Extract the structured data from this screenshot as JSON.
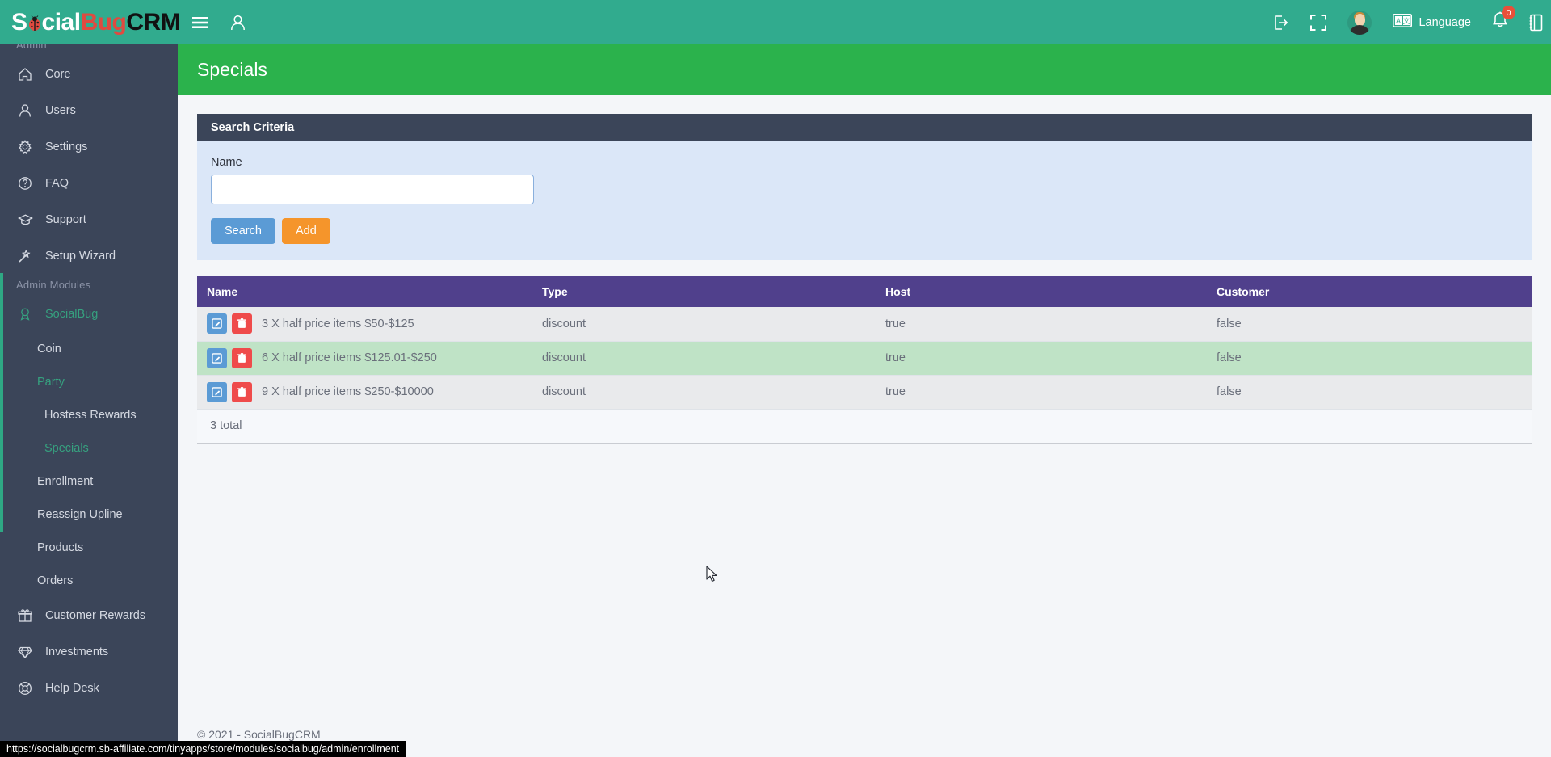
{
  "header": {
    "brand": {
      "part1": "S",
      "bug_glyph": "ladybug-icon",
      "part1b": "cial",
      "part2": "Bug",
      "part3": "CRM"
    },
    "left_icons": [
      {
        "name": "hamburger-menu-icon",
        "label": "Menu"
      },
      {
        "name": "user-icon",
        "label": "User"
      }
    ],
    "right_icons": [
      {
        "name": "logout-icon",
        "label": "Logout"
      },
      {
        "name": "fullscreen-icon",
        "label": "Fullscreen"
      },
      {
        "name": "avatar",
        "label": "Profile"
      }
    ],
    "language_label": "Language",
    "notification_count": "0",
    "accent_color": "#31ab8e"
  },
  "sidebar": {
    "section_admin": "Admin",
    "section_admin_modules": "Admin Modules",
    "admin_items": [
      {
        "label": "Core",
        "icon": "home-icon"
      },
      {
        "label": "Users",
        "icon": "user-icon"
      },
      {
        "label": "Settings",
        "icon": "gear-icon"
      },
      {
        "label": "FAQ",
        "icon": "question-circle-icon"
      },
      {
        "label": "Support",
        "icon": "graduation-cap-icon"
      },
      {
        "label": "Setup Wizard",
        "icon": "magic-wand-icon"
      }
    ],
    "module_socialbug": {
      "label": "SocialBug",
      "icon": "award-icon",
      "active": true
    },
    "socialbug_children": [
      {
        "label": "Coin",
        "active": false
      },
      {
        "label": "Party",
        "active": true
      },
      {
        "label": "Hostess Rewards",
        "active": false,
        "deep": true
      },
      {
        "label": "Specials",
        "active": true,
        "deep": true
      },
      {
        "label": "Enrollment",
        "active": false
      },
      {
        "label": "Reassign Upline",
        "active": false
      },
      {
        "label": "Products",
        "active": false
      },
      {
        "label": "Orders",
        "active": false
      }
    ],
    "other_modules": [
      {
        "label": "Customer Rewards",
        "icon": "gift-icon"
      },
      {
        "label": "Investments",
        "icon": "diamond-icon"
      },
      {
        "label": "Help Desk",
        "icon": "life-ring-icon"
      }
    ],
    "active_color": "#36a17f",
    "background_color": "#3b4559"
  },
  "page": {
    "title": "Specials",
    "title_bar_color": "#2bb24c"
  },
  "search_panel": {
    "heading": "Search Criteria",
    "name_label": "Name",
    "name_value": "",
    "name_placeholder": "",
    "search_button": "Search",
    "add_button": "Add"
  },
  "table": {
    "columns": [
      "Name",
      "Type",
      "Host",
      "Customer"
    ],
    "header_color": "#50408c",
    "rows": [
      {
        "name": "3 X half price items $50-$125",
        "type": "discount",
        "host": "true",
        "customer": "false",
        "highlight": false
      },
      {
        "name": "6 X half price items $125.01-$250",
        "type": "discount",
        "host": "true",
        "customer": "false",
        "highlight": true
      },
      {
        "name": "9 X half price items $250-$10000",
        "type": "discount",
        "host": "true",
        "customer": "false",
        "highlight": false
      }
    ],
    "total_label": "3 total",
    "edit_icon": "pencil-square-icon",
    "delete_icon": "trash-icon"
  },
  "footer": {
    "copyright": "© 2021 - SocialBugCRM"
  },
  "statusbar": {
    "url": "https://socialbugcrm.sb-affiliate.com/tinyapps/store/modules/socialbug/admin/enrollment"
  }
}
